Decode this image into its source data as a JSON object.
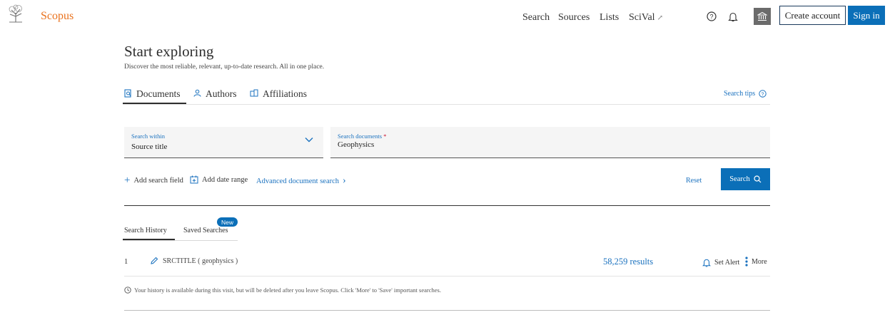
{
  "header": {
    "brand": "Scopus",
    "nav": [
      {
        "label": "Search"
      },
      {
        "label": "Sources"
      },
      {
        "label": "Lists"
      },
      {
        "label": "SciVal",
        "external": "↗"
      }
    ],
    "create_account": "Create account",
    "sign_in": "Sign in",
    "icons": [
      "help-icon",
      "bell-icon",
      "institution-icon"
    ]
  },
  "hero": {
    "title": "Start exploring",
    "subtitle": "Discover the most reliable, relevant, up-to-date research. All in one place."
  },
  "tabs": [
    {
      "label": "Documents",
      "icon": "document-search-icon",
      "active": true
    },
    {
      "label": "Authors",
      "icon": "person-icon"
    },
    {
      "label": "Affiliations",
      "icon": "building-icon"
    }
  ],
  "search_tips": "Search tips",
  "search": {
    "within_label": "Search within",
    "within_value": "Source title",
    "documents_label": "Search documents",
    "required_marker": "*",
    "documents_value": "Geophysics"
  },
  "actions": {
    "add_field": "Add search field",
    "add_date": "Add date range",
    "advanced": "Advanced document search",
    "advanced_chevron": "›",
    "reset": "Reset",
    "search": "Search"
  },
  "history": {
    "tabs": [
      {
        "label": "Search History",
        "active": true
      },
      {
        "label": "Saved Searches",
        "badge": "New"
      }
    ],
    "rows": [
      {
        "num": "1",
        "query": "SRCTITLE ( geophysics )",
        "results": "58,259 results",
        "alert": "Set Alert",
        "more": "More"
      }
    ],
    "note": "Your history is available during this visit, but will be deleted after you leave Scopus. Click 'More' to 'Save' important searches."
  },
  "colors": {
    "brand": "#e9711c",
    "accent": "#0b6fb8",
    "link": "#1b72bf"
  }
}
